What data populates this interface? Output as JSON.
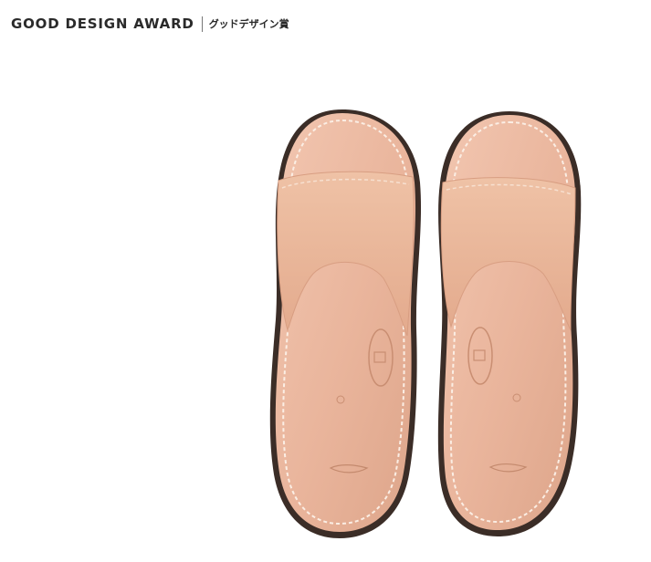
{
  "header": {
    "title": "GOOD DESIGN AWARD",
    "subtitle_jp": "グッドデザイン賞"
  },
  "photo": {
    "subject": "leather-slippers",
    "colors": {
      "leather": "#e8b49a",
      "sole": "#3a2c26",
      "stitch": "#fbeee4",
      "background": "#ffffff"
    }
  }
}
